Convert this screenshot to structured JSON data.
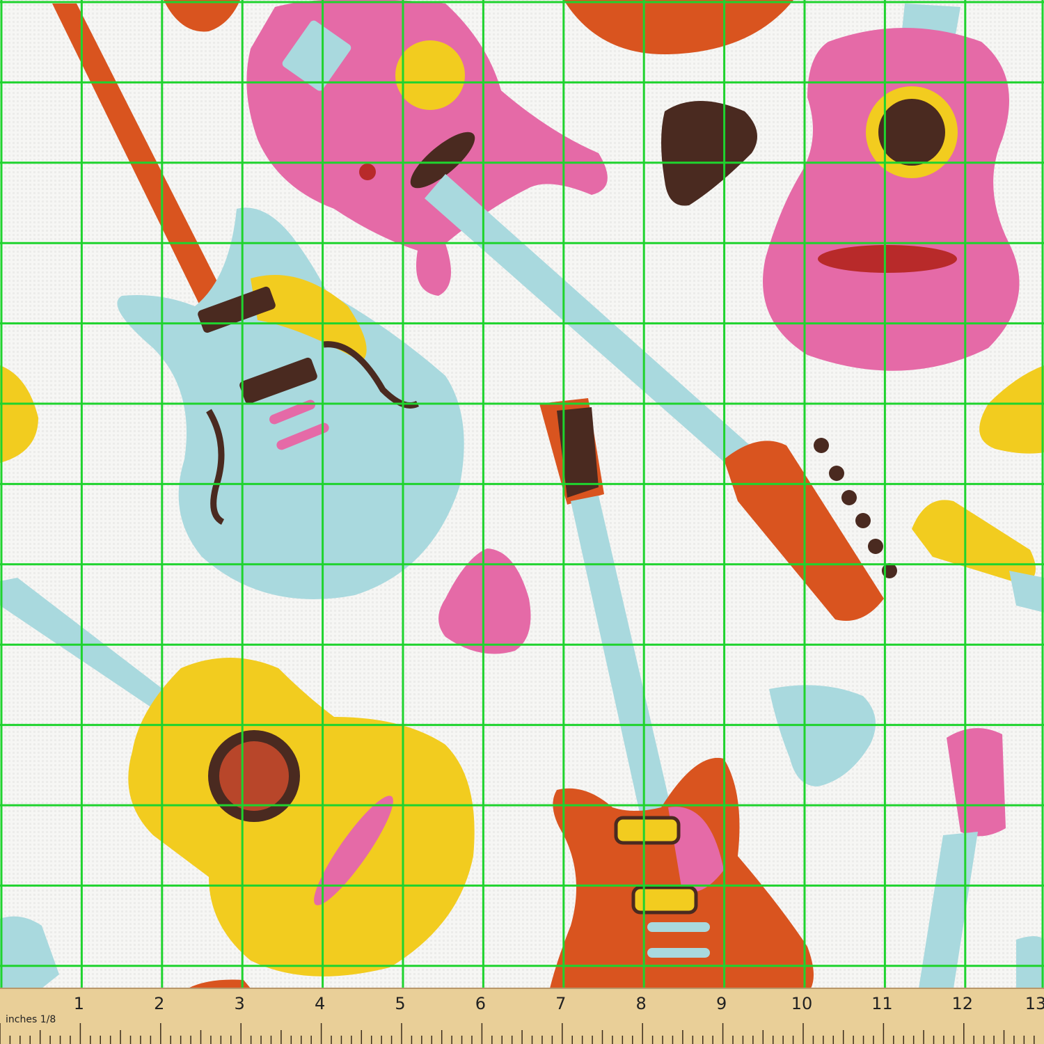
{
  "ruler": {
    "unit_label": "inches 1/8",
    "numbers": [
      "1",
      "2",
      "3",
      "4",
      "5",
      "6",
      "7",
      "8",
      "9",
      "10",
      "11",
      "12",
      "13"
    ]
  },
  "colors": {
    "background": "#f6f6f4",
    "grid": "#1fd32e",
    "pink": "#e56aa7",
    "light_blue": "#a9d9de",
    "yellow": "#f2cc1f",
    "orange": "#d9541f",
    "dark_brown": "#4a2a20",
    "ruler_wood": "#e9cf98"
  },
  "pattern": {
    "motif": "guitar-print-fabric",
    "items": [
      "pink-electric-guitar",
      "pink-acoustic-guitar",
      "light-blue-electric-guitar",
      "yellow-acoustic-guitar",
      "orange-electric-guitar",
      "dark-guitar-pick",
      "pink-guitar-pick",
      "light-blue-guitar-pick",
      "yellow-guitar-pick"
    ]
  }
}
